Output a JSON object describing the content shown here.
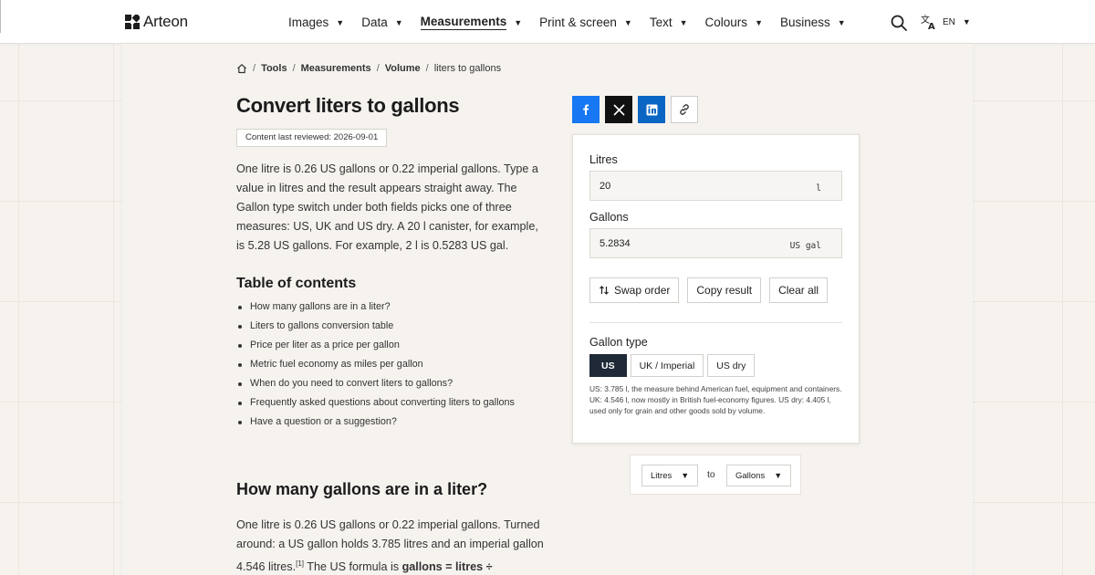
{
  "brand": {
    "name": "Arteon"
  },
  "nav": {
    "items": [
      {
        "label": "Images"
      },
      {
        "label": "Data"
      },
      {
        "label": "Measurements"
      },
      {
        "label": "Print & screen"
      },
      {
        "label": "Text"
      },
      {
        "label": "Colours"
      },
      {
        "label": "Business"
      }
    ],
    "active": "Measurements",
    "lang": "EN"
  },
  "breadcrumb": {
    "items": [
      "Tools",
      "Measurements",
      "Volume"
    ],
    "current": "liters to gallons"
  },
  "page": {
    "title": "Convert liters to gallons",
    "reviewed": "Content last reviewed: 2026-09-01",
    "intro": "One litre is 0.26 US gallons or 0.22 imperial gallons. Type a value in litres and the result appears straight away. The Gallon type switch under both fields picks one of three measures: US, UK and US dry. A 20 l canister, for example, is 5.28 US gallons. For example, 2 l is 0.5283 US gal."
  },
  "toc": {
    "title": "Table of contents",
    "items": [
      "How many gallons are in a liter?",
      "Liters to gallons conversion table",
      "Price per liter as a price per gallon",
      "Metric fuel economy as miles per gallon",
      "When do you need to convert liters to gallons?",
      "Frequently asked questions about converting liters to gallons",
      "Have a question or a suggestion?"
    ]
  },
  "section": {
    "heading": "How many gallons are in a liter?",
    "body_part1": "One litre is 0.26 US gallons or 0.22 imperial gallons. Turned around: a US gallon holds 3.785 litres and an imperial gallon 4.546 litres.",
    "footnote": "[1]",
    "body_part2": " The US formula is ",
    "formula": "gallons = litres ÷"
  },
  "share": {
    "icons": [
      "facebook-icon",
      "x-icon",
      "linkedin-icon",
      "link-icon"
    ]
  },
  "converter": {
    "from_label": "Litres",
    "from_value": "20",
    "from_unit": "l",
    "to_label": "Gallons",
    "to_value": "5.2834",
    "to_unit": "US gal",
    "swap_label": "Swap order",
    "copy_label": "Copy result",
    "clear_label": "Clear all",
    "gallon_type_label": "Gallon type",
    "gallon_types": [
      "US",
      "UK / Imperial",
      "US dry"
    ],
    "selected_type": "US",
    "note": "US: 3.785 l, the measure behind American fuel, equipment and containers. UK: 4.546 l, now mostly in British fuel-economy figures. US dry: 4.405 l, used only for grain and other goods sold by volume."
  },
  "unit_switch": {
    "from": "Litres",
    "to_word": "to",
    "to": "Gallons"
  },
  "colors": {
    "accent_dark": "#1f2937",
    "facebook": "#1877f2",
    "linkedin": "#0a66c2",
    "background": "#f6f3ef"
  }
}
